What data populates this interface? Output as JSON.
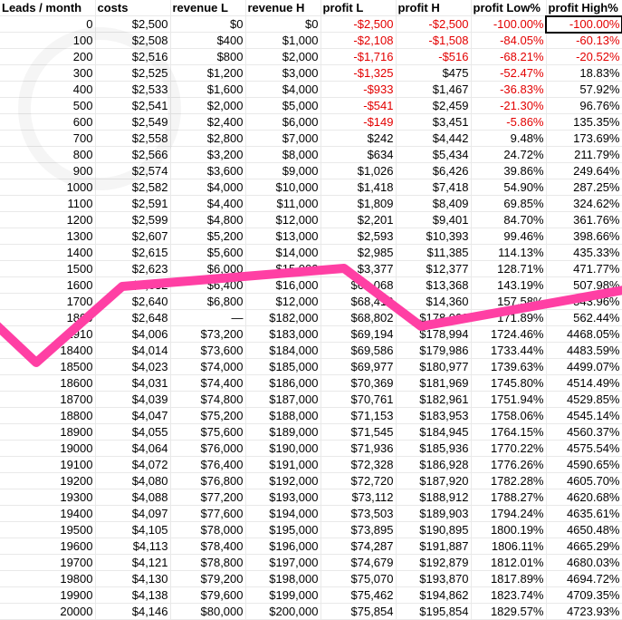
{
  "headers": [
    "Leads / month",
    "costs",
    "revenue L",
    "revenue H",
    "profit L",
    "profit H",
    "profit Low%",
    "profit High%"
  ],
  "rows": [
    {
      "leads": "0",
      "costs": "$2,500",
      "revL": "$0",
      "revH": "$0",
      "pL": "-$2,500",
      "pH": "-$2,500",
      "low": "-100.00%",
      "high": "-100.00%"
    },
    {
      "leads": "100",
      "costs": "$2,508",
      "revL": "$400",
      "revH": "$1,000",
      "pL": "-$2,108",
      "pH": "-$1,508",
      "low": "-84.05%",
      "high": "-60.13%"
    },
    {
      "leads": "200",
      "costs": "$2,516",
      "revL": "$800",
      "revH": "$2,000",
      "pL": "-$1,716",
      "pH": "-$516",
      "low": "-68.21%",
      "high": "-20.52%"
    },
    {
      "leads": "300",
      "costs": "$2,525",
      "revL": "$1,200",
      "revH": "$3,000",
      "pL": "-$1,325",
      "pH": "$475",
      "low": "-52.47%",
      "high": "18.83%"
    },
    {
      "leads": "400",
      "costs": "$2,533",
      "revL": "$1,600",
      "revH": "$4,000",
      "pL": "-$933",
      "pH": "$1,467",
      "low": "-36.83%",
      "high": "57.92%"
    },
    {
      "leads": "500",
      "costs": "$2,541",
      "revL": "$2,000",
      "revH": "$5,000",
      "pL": "-$541",
      "pH": "$2,459",
      "low": "-21.30%",
      "high": "96.76%"
    },
    {
      "leads": "600",
      "costs": "$2,549",
      "revL": "$2,400",
      "revH": "$6,000",
      "pL": "-$149",
      "pH": "$3,451",
      "low": "-5.86%",
      "high": "135.35%"
    },
    {
      "leads": "700",
      "costs": "$2,558",
      "revL": "$2,800",
      "revH": "$7,000",
      "pL": "$242",
      "pH": "$4,442",
      "low": "9.48%",
      "high": "173.69%"
    },
    {
      "leads": "800",
      "costs": "$2,566",
      "revL": "$3,200",
      "revH": "$8,000",
      "pL": "$634",
      "pH": "$5,434",
      "low": "24.72%",
      "high": "211.79%"
    },
    {
      "leads": "900",
      "costs": "$2,574",
      "revL": "$3,600",
      "revH": "$9,000",
      "pL": "$1,026",
      "pH": "$6,426",
      "low": "39.86%",
      "high": "249.64%"
    },
    {
      "leads": "1000",
      "costs": "$2,582",
      "revL": "$4,000",
      "revH": "$10,000",
      "pL": "$1,418",
      "pH": "$7,418",
      "low": "54.90%",
      "high": "287.25%"
    },
    {
      "leads": "1100",
      "costs": "$2,591",
      "revL": "$4,400",
      "revH": "$11,000",
      "pL": "$1,809",
      "pH": "$8,409",
      "low": "69.85%",
      "high": "324.62%"
    },
    {
      "leads": "1200",
      "costs": "$2,599",
      "revL": "$4,800",
      "revH": "$12,000",
      "pL": "$2,201",
      "pH": "$9,401",
      "low": "84.70%",
      "high": "361.76%"
    },
    {
      "leads": "1300",
      "costs": "$2,607",
      "revL": "$5,200",
      "revH": "$13,000",
      "pL": "$2,593",
      "pH": "$10,393",
      "low": "99.46%",
      "high": "398.66%"
    },
    {
      "leads": "1400",
      "costs": "$2,615",
      "revL": "$5,600",
      "revH": "$14,000",
      "pL": "$2,985",
      "pH": "$11,385",
      "low": "114.13%",
      "high": "435.33%"
    },
    {
      "leads": "1500",
      "costs": "$2,623",
      "revL": "$6,000",
      "revH": "$15,000",
      "pL": "$3,377",
      "pH": "$12,377",
      "low": "128.71%",
      "high": "471.77%"
    },
    {
      "leads": "1600",
      "costs": "$2,632",
      "revL": "$6,400",
      "revH": "$16,000",
      "pL": "$68,068",
      "pH": "$13,368",
      "low": "143.19%",
      "high": "507.98%"
    },
    {
      "leads": "1700",
      "costs": "$2,640",
      "revL": "$6,800",
      "revH": "$12,000",
      "pL": "$68,410",
      "pH": "$14,360",
      "low": "157.58%",
      "high": "543.96%"
    },
    {
      "leads": "1800",
      "costs": "$2,648",
      "revL": "—",
      "revH": "$182,000",
      "pL": "$68,802",
      "pH": "$178,002",
      "low": "171.89%",
      "high": "562.44%"
    },
    {
      "leads": "1910",
      "costs": "$4,006",
      "revL": "$73,200",
      "revH": "$183,000",
      "pL": "$69,194",
      "pH": "$178,994",
      "low": "1724.46%",
      "high": "4468.05%"
    },
    {
      "leads": "18400",
      "costs": "$4,014",
      "revL": "$73,600",
      "revH": "$184,000",
      "pL": "$69,586",
      "pH": "$179,986",
      "low": "1733.44%",
      "high": "4483.59%"
    },
    {
      "leads": "18500",
      "costs": "$4,023",
      "revL": "$74,000",
      "revH": "$185,000",
      "pL": "$69,977",
      "pH": "$180,977",
      "low": "1739.63%",
      "high": "4499.07%"
    },
    {
      "leads": "18600",
      "costs": "$4,031",
      "revL": "$74,400",
      "revH": "$186,000",
      "pL": "$70,369",
      "pH": "$181,969",
      "low": "1745.80%",
      "high": "4514.49%"
    },
    {
      "leads": "18700",
      "costs": "$4,039",
      "revL": "$74,800",
      "revH": "$187,000",
      "pL": "$70,761",
      "pH": "$182,961",
      "low": "1751.94%",
      "high": "4529.85%"
    },
    {
      "leads": "18800",
      "costs": "$4,047",
      "revL": "$75,200",
      "revH": "$188,000",
      "pL": "$71,153",
      "pH": "$183,953",
      "low": "1758.06%",
      "high": "4545.14%"
    },
    {
      "leads": "18900",
      "costs": "$4,055",
      "revL": "$75,600",
      "revH": "$189,000",
      "pL": "$71,545",
      "pH": "$184,945",
      "low": "1764.15%",
      "high": "4560.37%"
    },
    {
      "leads": "19000",
      "costs": "$4,064",
      "revL": "$76,000",
      "revH": "$190,000",
      "pL": "$71,936",
      "pH": "$185,936",
      "low": "1770.22%",
      "high": "4575.54%"
    },
    {
      "leads": "19100",
      "costs": "$4,072",
      "revL": "$76,400",
      "revH": "$191,000",
      "pL": "$72,328",
      "pH": "$186,928",
      "low": "1776.26%",
      "high": "4590.65%"
    },
    {
      "leads": "19200",
      "costs": "$4,080",
      "revL": "$76,800",
      "revH": "$192,000",
      "pL": "$72,720",
      "pH": "$187,920",
      "low": "1782.28%",
      "high": "4605.70%"
    },
    {
      "leads": "19300",
      "costs": "$4,088",
      "revL": "$77,200",
      "revH": "$193,000",
      "pL": "$73,112",
      "pH": "$188,912",
      "low": "1788.27%",
      "high": "4620.68%"
    },
    {
      "leads": "19400",
      "costs": "$4,097",
      "revL": "$77,600",
      "revH": "$194,000",
      "pL": "$73,503",
      "pH": "$189,903",
      "low": "1794.24%",
      "high": "4635.61%"
    },
    {
      "leads": "19500",
      "costs": "$4,105",
      "revL": "$78,000",
      "revH": "$195,000",
      "pL": "$73,895",
      "pH": "$190,895",
      "low": "1800.19%",
      "high": "4650.48%"
    },
    {
      "leads": "19600",
      "costs": "$4,113",
      "revL": "$78,400",
      "revH": "$196,000",
      "pL": "$74,287",
      "pH": "$191,887",
      "low": "1806.11%",
      "high": "4665.29%"
    },
    {
      "leads": "19700",
      "costs": "$4,121",
      "revL": "$78,800",
      "revH": "$197,000",
      "pL": "$74,679",
      "pH": "$192,879",
      "low": "1812.01%",
      "high": "4680.03%"
    },
    {
      "leads": "19800",
      "costs": "$4,130",
      "revL": "$79,200",
      "revH": "$198,000",
      "pL": "$75,070",
      "pH": "$193,870",
      "low": "1817.89%",
      "high": "4694.72%"
    },
    {
      "leads": "19900",
      "costs": "$4,138",
      "revL": "$79,600",
      "revH": "$199,000",
      "pL": "$75,462",
      "pH": "$194,862",
      "low": "1823.74%",
      "high": "4709.35%"
    },
    {
      "leads": "20000",
      "costs": "$4,146",
      "revL": "$80,000",
      "revH": "$200,000",
      "pL": "$75,854",
      "pH": "$195,854",
      "low": "1829.57%",
      "high": "4723.93%"
    }
  ],
  "selected_cell": {
    "row": 0,
    "col": 7
  }
}
